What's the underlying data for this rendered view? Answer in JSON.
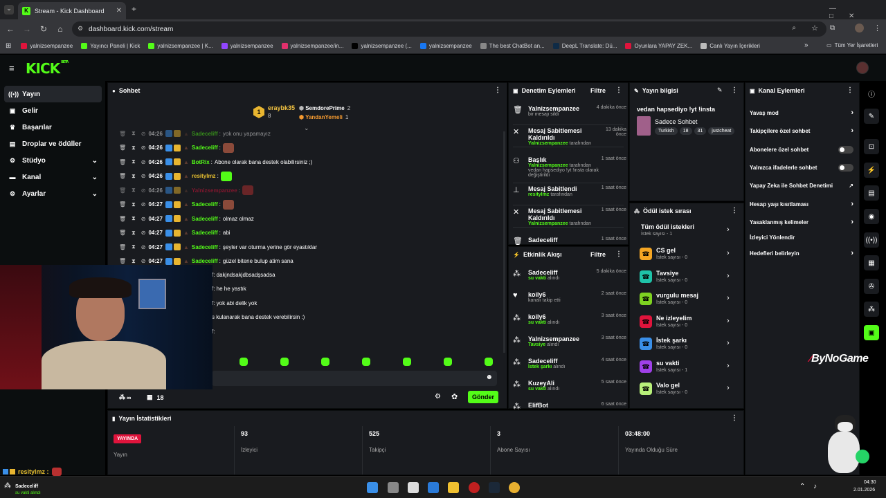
{
  "browser": {
    "tab_title": "Stream - Kick Dashboard",
    "tab_close": "✕",
    "new_tab": "+",
    "url": "dashboard.kick.com/stream",
    "bookmarks": [
      "yalnizsempanzee",
      "Yayıncı Paneli | Kick",
      "yalnizsempanzee | K...",
      "yalnizsempanzee",
      "yalnizsempanzee/in...",
      "yalnizsempanzee (...",
      "yalnizsempanzee",
      "The best ChatBot an...",
      "DeepL Translate: Dü...",
      "Oyunlara YAPAY ZEK...",
      "Canlı Yayın İçerikleri"
    ],
    "all_bookmarks": "Tüm Yer İşaretleri",
    "bm_more": "»"
  },
  "header": {
    "logo": "KICK",
    "beta": "BETA"
  },
  "sidebar": {
    "items": [
      {
        "label": "Yayın",
        "icon": "broadcast-icon"
      },
      {
        "label": "Gelir",
        "icon": "revenue-icon"
      },
      {
        "label": "Başarılar",
        "icon": "trophy-icon"
      },
      {
        "label": "Droplar ve ödüller",
        "icon": "gift-icon"
      },
      {
        "label": "Stüdyo",
        "icon": "studio-icon"
      },
      {
        "label": "Kanal",
        "icon": "channel-icon"
      },
      {
        "label": "Ayarlar",
        "icon": "settings-icon"
      }
    ]
  },
  "chat": {
    "title": "Sohbet",
    "leaderboard": {
      "first": {
        "name": "eraybk35",
        "score": "8"
      },
      "second": {
        "name": "SemdorePrime",
        "score": "2"
      },
      "third": {
        "name": "YandanYemeli",
        "score": "1"
      }
    },
    "messages": [
      {
        "time": "04:26",
        "user": "Sadeceliff",
        "text": "yok onu yapamayız",
        "color": "#53fc18"
      },
      {
        "time": "04:26",
        "user": "Sadeceliff",
        "text": "",
        "color": "#53fc18",
        "emote": "#8b4a3a"
      },
      {
        "time": "04:26",
        "user": "BotRix",
        "text": "Abone olarak bana destek olabilirsiniz ;)",
        "color": "#53fc18"
      },
      {
        "time": "04:26",
        "user": "resitylmz",
        "text": "",
        "color": "#e8c030",
        "emote": "#53fc18"
      },
      {
        "time": "04:26",
        "user": "Yalnizsempanzee",
        "text": "",
        "color": "#e0143c",
        "emote": "#b83030"
      },
      {
        "time": "04:27",
        "user": "Sadeceliff",
        "text": "",
        "color": "#53fc18",
        "emote": "#8b4a3a"
      },
      {
        "time": "04:27",
        "user": "Sadeceliff",
        "text": "olmaz olmaz",
        "color": "#53fc18"
      },
      {
        "time": "04:27",
        "user": "Sadeceliff",
        "text": "abi",
        "color": "#53fc18"
      },
      {
        "time": "04:27",
        "user": "Sadeceliff",
        "text": "şeyler var oturma yerine gör eyastıklar",
        "color": "#53fc18"
      },
      {
        "time": "04:27",
        "user": "Sadeceliff",
        "text": "güzel bitene bulup atim sana",
        "color": "#53fc18"
      }
    ],
    "partial_lines": [
      "f: dakjndsakjdbsadşsadsa",
      "f: he he yastık",
      "f: yok abi delik yok",
      "s kulanarak bana destek verebilirsin :)",
      "f:"
    ],
    "viewers_limit": "∞",
    "slow": "18",
    "send": "Gönder"
  },
  "moderation": {
    "title": "Denetim Eylemleri",
    "filter": "Filtre",
    "items": [
      {
        "name": "Yalnizsempanzee",
        "sub": "bir mesajı sildi",
        "time": "4 dakika önce"
      },
      {
        "name": "Mesaj Sabitlemesi Kaldırıldı",
        "sub_user": "Yalnizsempanzee",
        "sub": "tarafından",
        "time": "13 dakika önce"
      },
      {
        "name": "Başlık",
        "sub_user": "Yalnizsempanzee",
        "sub": "tarafından vedan hapsediyo !yt !insta olarak değiştirildi",
        "time": "1 saat önce"
      },
      {
        "name": "Mesaj Sabitlendi",
        "sub_user": "resitylmz",
        "sub": "tarafından",
        "time": "1 saat önce"
      },
      {
        "name": "Mesaj Sabitlemesi Kaldırıldı",
        "sub_user": "Yalnizsempanzee",
        "sub": "tarafından",
        "time": "1 saat önce"
      },
      {
        "name": "Sadeceliff",
        "sub": "",
        "time": "1 saat önce"
      }
    ]
  },
  "activity": {
    "title": "Etkinlik Akışı",
    "filter": "Filtre",
    "items": [
      {
        "name": "Sadeceliff",
        "hl": "su vakti",
        "sub": "alındı",
        "time": "5 dakika önce"
      },
      {
        "name": "koily6",
        "hl": "",
        "sub": "kanalı takip etti",
        "time": "2 saat önce"
      },
      {
        "name": "koily6",
        "hl": "su vakti",
        "sub": "alındı",
        "time": "3 saat önce"
      },
      {
        "name": "Yalnizsempanzee",
        "hl": "Tavsiye",
        "sub": "alındı",
        "time": "3 saat önce"
      },
      {
        "name": "Sadeceliff",
        "hl": "İstek şarkı",
        "sub": "alındı",
        "time": "4 saat önce"
      },
      {
        "name": "KuzeyAli",
        "hl": "su vakti",
        "sub": "alındı",
        "time": "5 saat önce"
      },
      {
        "name": "ElifBot",
        "hl": "",
        "sub": "",
        "time": "6 saat önce"
      }
    ]
  },
  "stream_info": {
    "title": "Yayın bilgisi",
    "stream_title": "vedan hapsediyo !yt !insta",
    "category": "Sadece Sohbet",
    "tags": [
      "Turkish",
      "18",
      "31",
      "justcheat"
    ]
  },
  "rewards": {
    "title": "Ödül istek sırası",
    "all": {
      "name": "Tüm ödül istekleri",
      "sub": "İstek sayısı - 1"
    },
    "items": [
      {
        "name": "CS gel",
        "sub": "İstek sayısı - 0",
        "color": "#f5a623"
      },
      {
        "name": "Tavsiye",
        "sub": "İstek sayısı - 0",
        "color": "#1fc2a8"
      },
      {
        "name": "vurgulu mesaj",
        "sub": "İstek sayısı - 0",
        "color": "#7ed321"
      },
      {
        "name": "Ne izleyelim",
        "sub": "İstek sayısı - 0",
        "color": "#e0143c"
      },
      {
        "name": "İstek şarkı",
        "sub": "İstek sayısı - 0",
        "color": "#3a8fe8"
      },
      {
        "name": "su vakti",
        "sub": "İstek sayısı - 1",
        "color": "#a040e8"
      },
      {
        "name": "Valo gel",
        "sub": "İstek sayısı - 0",
        "color": "#b8f07a"
      }
    ]
  },
  "channel_actions": {
    "title": "Kanal Eylemleri",
    "items": [
      {
        "label": "Yavaş mod",
        "type": "chev"
      },
      {
        "label": "Takipçilere özel sohbet",
        "type": "chev"
      },
      {
        "label": "Abonelere özel sohbet",
        "type": "toggle"
      },
      {
        "label": "Yalnızca ifadelerle sohbet",
        "type": "toggle"
      },
      {
        "label": "Yapay Zeka ile Sohbet Denetimi",
        "type": "ext"
      },
      {
        "label": "Hesap yaşı kısıtlaması",
        "type": "chev"
      },
      {
        "label": "Yasaklanmış kelimeler",
        "type": "chev"
      },
      {
        "label": "İzleyici Yönlendir",
        "type": "none"
      },
      {
        "label": "Hedefleri belirleyin",
        "type": "chev"
      }
    ]
  },
  "stats": {
    "title": "Yayın İstatistikleri",
    "live_badge": "YAYINDA",
    "items": [
      {
        "value": "",
        "label": "Yayın"
      },
      {
        "value": "93",
        "label": "İzleyici"
      },
      {
        "value": "525",
        "label": "Takipçi"
      },
      {
        "value": "3",
        "label": "Abone Sayısı"
      },
      {
        "value": "03:48:00",
        "label": "Yayında Olduğu Süre"
      }
    ]
  },
  "overlay": {
    "watermark": "ByNoGame",
    "overlay_chat_user": "resitylmz :",
    "toast_name": "Sadeceliff",
    "toast_sub": "su vakti alındı"
  },
  "taskbar": {
    "time": "04:30",
    "date": "2.01.2026"
  }
}
